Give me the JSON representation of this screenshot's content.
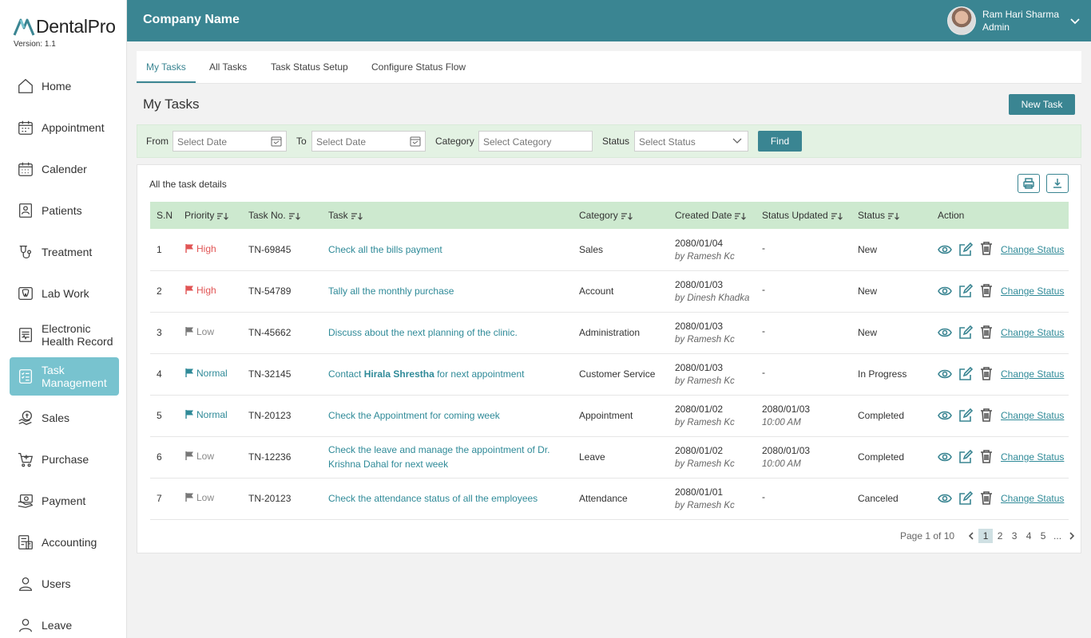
{
  "brand": {
    "name": "DentalPro",
    "version": "Version: 1.1"
  },
  "sidebar": {
    "items": [
      {
        "label": "Home",
        "icon": "home-icon"
      },
      {
        "label": "Appointment",
        "icon": "appointment-icon"
      },
      {
        "label": "Calender",
        "icon": "calendar-icon"
      },
      {
        "label": "Patients",
        "icon": "patients-icon"
      },
      {
        "label": "Treatment",
        "icon": "treatment-icon"
      },
      {
        "label": "Lab Work",
        "icon": "lab-work-icon"
      },
      {
        "label": "Electronic Health Record",
        "icon": "health-record-icon"
      },
      {
        "label": "Task Management",
        "icon": "task-icon",
        "active": true
      },
      {
        "label": "Sales",
        "icon": "sales-icon"
      },
      {
        "label": "Purchase",
        "icon": "purchase-icon"
      },
      {
        "label": "Payment",
        "icon": "payment-icon"
      },
      {
        "label": "Accounting",
        "icon": "accounting-icon"
      },
      {
        "label": "Users",
        "icon": "users-icon"
      },
      {
        "label": "Leave",
        "icon": "leave-icon"
      }
    ]
  },
  "header": {
    "company": "Company Name",
    "user_name": "Ram Hari Sharma",
    "user_role": "Admin"
  },
  "tabs": [
    "My Tasks",
    "All Tasks",
    "Task Status Setup",
    "Configure Status Flow"
  ],
  "page": {
    "title": "My Tasks",
    "new_task": "New Task"
  },
  "filters": {
    "from_label": "From",
    "from_placeholder": "Select Date",
    "to_label": "To",
    "to_placeholder": "Select Date",
    "category_label": "Category",
    "category_placeholder": "Select Category",
    "status_label": "Status",
    "status_placeholder": "Select Status",
    "find": "Find"
  },
  "table": {
    "caption": "All the task details",
    "columns": [
      "S.N",
      "Priority",
      "Task No.",
      "Task",
      "Category",
      "Created Date",
      "Status Updated",
      "Status",
      "Action"
    ],
    "action_label": "Change Status",
    "rows": [
      {
        "sn": "1",
        "priority": "High",
        "task_no": "TN-69845",
        "task": "Check all the bills payment",
        "task_bold": "",
        "task_after": "",
        "category": "Sales",
        "created": "2080/01/04",
        "created_by": "by Ramesh Kc",
        "updated": "-",
        "updated_time": "",
        "status": "New"
      },
      {
        "sn": "2",
        "priority": "High",
        "task_no": "TN-54789",
        "task": "Tally all the monthly purchase",
        "task_bold": "",
        "task_after": "",
        "category": "Account",
        "created": "2080/01/03",
        "created_by": "by Dinesh Khadka",
        "updated": "-",
        "updated_time": "",
        "status": "New"
      },
      {
        "sn": "3",
        "priority": "Low",
        "task_no": "TN-45662",
        "task": "Discuss about the next planning of the clinic.",
        "task_bold": "",
        "task_after": "",
        "category": "Administration",
        "created": "2080/01/03",
        "created_by": "by Ramesh Kc",
        "updated": "-",
        "updated_time": "",
        "status": "New"
      },
      {
        "sn": "4",
        "priority": "Normal",
        "task_no": "TN-32145",
        "task": "Contact ",
        "task_bold": "Hirala Shrestha",
        "task_after": " for next appointment",
        "category": "Customer Service",
        "created": "2080/01/03",
        "created_by": "by Ramesh Kc",
        "updated": "-",
        "updated_time": "",
        "status": "In Progress"
      },
      {
        "sn": "5",
        "priority": "Normal",
        "task_no": "TN-20123",
        "task": "Check the Appointment for coming week",
        "task_bold": "",
        "task_after": "",
        "category": "Appointment",
        "created": "2080/01/02",
        "created_by": "by Ramesh Kc",
        "updated": "2080/01/03",
        "updated_time": "10:00 AM",
        "status": "Completed"
      },
      {
        "sn": "6",
        "priority": "Low",
        "task_no": "TN-12236",
        "task": "Check the leave and manage the appointment of Dr. Krishna Dahal for next week",
        "task_bold": "",
        "task_after": "",
        "category": "Leave",
        "created": "2080/01/02",
        "created_by": "by Ramesh Kc",
        "updated": "2080/01/03",
        "updated_time": "10:00 AM",
        "status": "Completed"
      },
      {
        "sn": "7",
        "priority": "Low",
        "task_no": "TN-20123",
        "task": "Check the attendance status of all the employees",
        "task_bold": "",
        "task_after": "",
        "category": "Attendance",
        "created": "2080/01/01",
        "created_by": "by Ramesh Kc",
        "updated": "-",
        "updated_time": "",
        "status": "Canceled"
      }
    ]
  },
  "pagination": {
    "label": "Page 1 of 10",
    "pages": [
      "1",
      "2",
      "3",
      "4",
      "5"
    ],
    "ellipsis": "...",
    "current": "1"
  },
  "colors": {
    "primary": "#3a8592",
    "active_nav": "#78c3cf",
    "high": "#e15555",
    "normal": "#2f8a98",
    "low": "#888888",
    "table_header": "#cde9cf"
  }
}
